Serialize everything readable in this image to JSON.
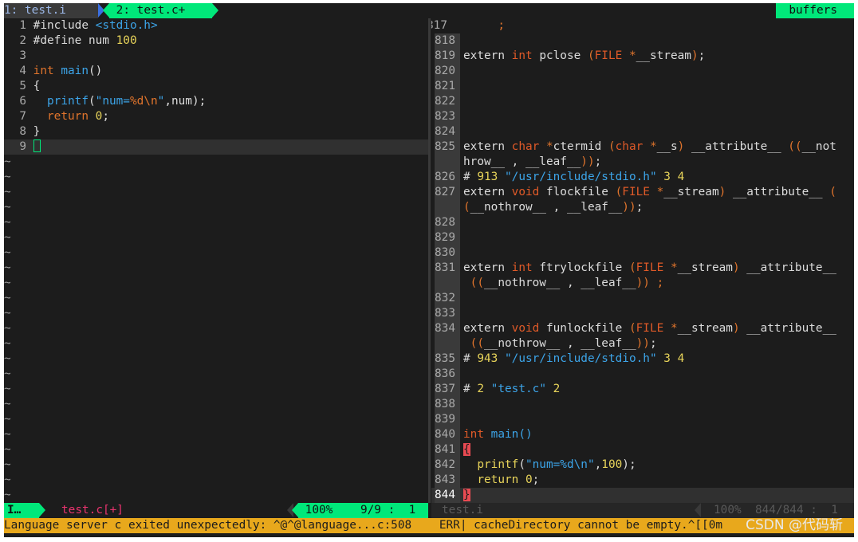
{
  "tabline": {
    "tab1": "1: test.i",
    "tab2": "2: test.c+",
    "buffers": "buffers"
  },
  "left_pane": {
    "lines": [
      {
        "n": "1",
        "parts": [
          [
            "pp",
            "#include "
          ],
          [
            "str",
            "<stdio.h>"
          ]
        ]
      },
      {
        "n": "2",
        "parts": [
          [
            "pp",
            "#define num "
          ],
          [
            "num",
            "100"
          ]
        ]
      },
      {
        "n": "3",
        "parts": []
      },
      {
        "n": "4",
        "parts": [
          [
            "kw",
            "int"
          ],
          [
            "plain",
            " "
          ],
          [
            "fn",
            "main"
          ],
          [
            "plain",
            "()"
          ]
        ]
      },
      {
        "n": "5",
        "parts": [
          [
            "plain",
            "{"
          ]
        ]
      },
      {
        "n": "6",
        "parts": [
          [
            "plain",
            "  "
          ],
          [
            "fn",
            "printf"
          ],
          [
            "plain",
            "("
          ],
          [
            "str",
            "\"num="
          ],
          [
            "kw",
            "%d\\n"
          ],
          [
            "str",
            "\""
          ],
          [
            "plain",
            ",num);"
          ]
        ]
      },
      {
        "n": "7",
        "parts": [
          [
            "plain",
            "  "
          ],
          [
            "kw",
            "return"
          ],
          [
            "plain",
            " "
          ],
          [
            "num",
            "0"
          ],
          [
            "plain",
            ";"
          ]
        ]
      },
      {
        "n": "8",
        "parts": [
          [
            "plain",
            "}"
          ]
        ]
      },
      {
        "n": "9",
        "parts": []
      }
    ],
    "tilde": "~",
    "tilde_count": 23
  },
  "right_pane": {
    "lines": [
      {
        "n": "817",
        "parts": [
          [
            "plain",
            "     "
          ],
          [
            "kw",
            ";"
          ]
        ]
      },
      {
        "n": "818",
        "parts": []
      },
      {
        "n": "819",
        "parts": [
          [
            "plain",
            "extern "
          ],
          [
            "type",
            "int"
          ],
          [
            "plain",
            " pclose "
          ],
          [
            "kw",
            "("
          ],
          [
            "type",
            "FILE"
          ],
          [
            "plain",
            " "
          ],
          [
            "kw",
            "*"
          ],
          [
            "plain",
            "__stream"
          ],
          [
            "kw",
            ")"
          ],
          [
            "plain",
            ";"
          ]
        ]
      },
      {
        "n": "820",
        "parts": []
      },
      {
        "n": "821",
        "parts": []
      },
      {
        "n": "822",
        "parts": []
      },
      {
        "n": "823",
        "parts": []
      },
      {
        "n": "824",
        "parts": []
      },
      {
        "n": "825",
        "parts": [
          [
            "plain",
            "extern "
          ],
          [
            "type",
            "char"
          ],
          [
            "plain",
            " "
          ],
          [
            "kw",
            "*"
          ],
          [
            "plain",
            "ctermid "
          ],
          [
            "kw",
            "("
          ],
          [
            "type",
            "char"
          ],
          [
            "plain",
            " "
          ],
          [
            "kw",
            "*"
          ],
          [
            "plain",
            "__s"
          ],
          [
            "kw",
            ")"
          ],
          [
            "plain",
            " __attribute__ "
          ],
          [
            "kw",
            "(("
          ],
          [
            "plain",
            "__not"
          ]
        ]
      },
      {
        "n": "",
        "parts": [
          [
            "plain",
            "hrow__ , __leaf__"
          ],
          [
            "kw",
            "))"
          ],
          [
            "plain",
            ";"
          ]
        ]
      },
      {
        "n": "826",
        "parts": [
          [
            "plain",
            "# "
          ],
          [
            "num",
            "913"
          ],
          [
            "plain",
            " "
          ],
          [
            "str",
            "\"/usr/include/stdio.h\""
          ],
          [
            "plain",
            " "
          ],
          [
            "num",
            "3"
          ],
          [
            "plain",
            " "
          ],
          [
            "num",
            "4"
          ]
        ]
      },
      {
        "n": "827",
        "parts": [
          [
            "plain",
            "extern "
          ],
          [
            "type",
            "void"
          ],
          [
            "plain",
            " flockfile "
          ],
          [
            "kw",
            "("
          ],
          [
            "type",
            "FILE"
          ],
          [
            "plain",
            " "
          ],
          [
            "kw",
            "*"
          ],
          [
            "plain",
            "__stream"
          ],
          [
            "kw",
            ")"
          ],
          [
            "plain",
            " __attribute__ "
          ],
          [
            "kw",
            "("
          ]
        ]
      },
      {
        "n": "",
        "parts": [
          [
            "kw",
            "("
          ],
          [
            "plain",
            "__nothrow__ , __leaf__"
          ],
          [
            "kw",
            "))"
          ],
          [
            "plain",
            ";"
          ]
        ]
      },
      {
        "n": "828",
        "parts": []
      },
      {
        "n": "829",
        "parts": []
      },
      {
        "n": "830",
        "parts": []
      },
      {
        "n": "831",
        "parts": [
          [
            "plain",
            "extern "
          ],
          [
            "type",
            "int"
          ],
          [
            "plain",
            " ftrylockfile "
          ],
          [
            "kw",
            "("
          ],
          [
            "type",
            "FILE"
          ],
          [
            "plain",
            " "
          ],
          [
            "kw",
            "*"
          ],
          [
            "plain",
            "__stream"
          ],
          [
            "kw",
            ")"
          ],
          [
            "plain",
            " __attribute__"
          ]
        ]
      },
      {
        "n": "",
        "parts": [
          [
            "plain",
            " "
          ],
          [
            "kw",
            "(("
          ],
          [
            "plain",
            "__nothrow__ , __leaf__"
          ],
          [
            "kw",
            "))"
          ],
          [
            "plain",
            " "
          ],
          [
            "kw",
            ";"
          ]
        ]
      },
      {
        "n": "832",
        "parts": []
      },
      {
        "n": "833",
        "parts": []
      },
      {
        "n": "834",
        "parts": [
          [
            "plain",
            "extern "
          ],
          [
            "type",
            "void"
          ],
          [
            "plain",
            " funlockfile "
          ],
          [
            "kw",
            "("
          ],
          [
            "type",
            "FILE"
          ],
          [
            "plain",
            " "
          ],
          [
            "kw",
            "*"
          ],
          [
            "plain",
            "__stream"
          ],
          [
            "kw",
            ")"
          ],
          [
            "plain",
            " __attribute__"
          ]
        ]
      },
      {
        "n": "",
        "parts": [
          [
            "plain",
            " "
          ],
          [
            "kw",
            "(("
          ],
          [
            "plain",
            "__nothrow__ , __leaf__"
          ],
          [
            "kw",
            "))"
          ],
          [
            "plain",
            ";"
          ]
        ]
      },
      {
        "n": "835",
        "parts": [
          [
            "plain",
            "# "
          ],
          [
            "num",
            "943"
          ],
          [
            "plain",
            " "
          ],
          [
            "str",
            "\"/usr/include/stdio.h\""
          ],
          [
            "plain",
            " "
          ],
          [
            "num",
            "3"
          ],
          [
            "plain",
            " "
          ],
          [
            "num",
            "4"
          ]
        ]
      },
      {
        "n": "836",
        "parts": []
      },
      {
        "n": "837",
        "parts": [
          [
            "plain",
            "# "
          ],
          [
            "num",
            "2"
          ],
          [
            "plain",
            " "
          ],
          [
            "str",
            "\"test.c\""
          ],
          [
            "plain",
            " "
          ],
          [
            "num",
            "2"
          ]
        ]
      },
      {
        "n": "838",
        "parts": []
      },
      {
        "n": "839",
        "parts": []
      },
      {
        "n": "840",
        "parts": [
          [
            "type",
            "int"
          ],
          [
            "plain",
            " "
          ],
          [
            "fn",
            "main"
          ],
          [
            "fn",
            "()"
          ]
        ]
      },
      {
        "n": "841",
        "parts": [
          [
            "err",
            "{"
          ]
        ]
      },
      {
        "n": "842",
        "parts": [
          [
            "plain",
            "  "
          ],
          [
            "num",
            "printf"
          ],
          [
            "plain",
            "("
          ],
          [
            "str",
            "\"num=%d\\n\""
          ],
          [
            "plain",
            ","
          ],
          [
            "num",
            "100"
          ],
          [
            "plain",
            ");"
          ]
        ]
      },
      {
        "n": "843",
        "parts": [
          [
            "plain",
            "  "
          ],
          [
            "num",
            "return"
          ],
          [
            "plain",
            " "
          ],
          [
            "num",
            "0"
          ],
          [
            "plain",
            ";"
          ]
        ]
      },
      {
        "n": "844",
        "parts": [
          [
            "err",
            "}"
          ]
        ]
      }
    ]
  },
  "statusline": {
    "mode": "I…",
    "left_file": "test.c[+]",
    "left_pos": " 100%    9/9 :  1",
    "right_file": "test.i",
    "right_pos": "100%  844/844 :  1"
  },
  "message": {
    "text": "Language server c exited unexpectedly: ^@^@language...c:508    ERR| cacheDirectory cannot be empty.^[[0m",
    "watermark": "CSDN @代码斩"
  }
}
